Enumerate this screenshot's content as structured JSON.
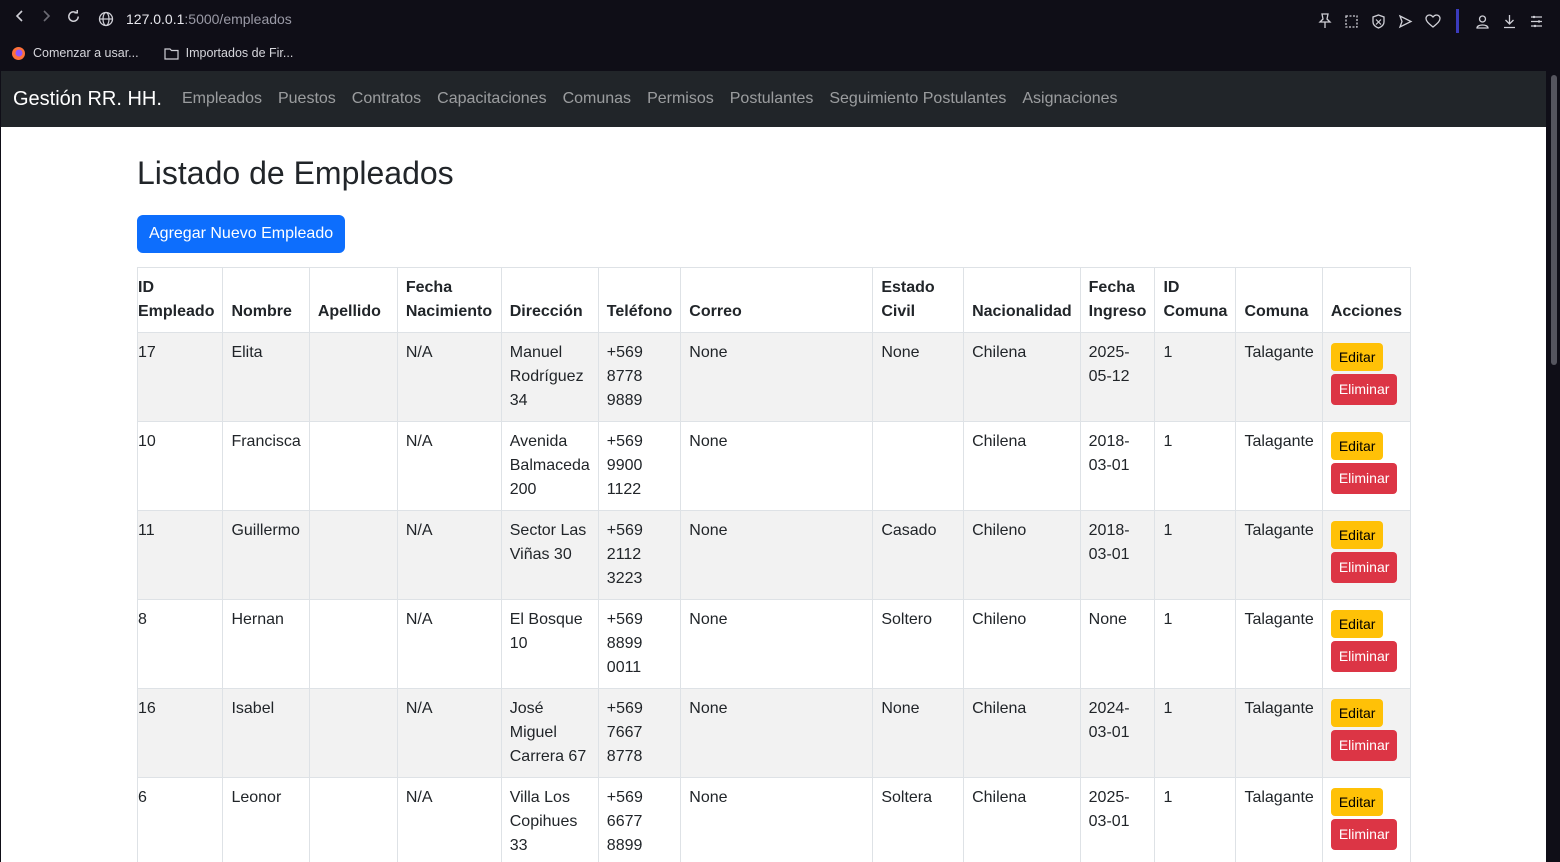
{
  "browser": {
    "url_host": "127.0.0.1",
    "url_path": ":5000/empleados",
    "bookmarks": [
      {
        "label": "Comenzar a usar...",
        "icon": "firefox-icon"
      },
      {
        "label": "Importados de Fir...",
        "icon": "folder-icon"
      }
    ],
    "accent_color": "#3b3bbd"
  },
  "navbar": {
    "brand": "Gestión RR. HH.",
    "links": [
      "Empleados",
      "Puestos",
      "Contratos",
      "Capacitaciones",
      "Comunas",
      "Permisos",
      "Postulantes",
      "Seguimiento Postulantes",
      "Asignaciones"
    ]
  },
  "page": {
    "title": "Listado de Empleados",
    "add_button": "Agregar Nuevo Empleado"
  },
  "table": {
    "headers": [
      "ID Empleado",
      "Nombre",
      "Apellido",
      "Fecha Nacimiento",
      "Dirección",
      "Teléfono",
      "Correo",
      "Estado Civil",
      "Nacionalidad",
      "Fecha Ingreso",
      "ID Comuna",
      "Comuna",
      "Acciones"
    ],
    "edit_label": "Editar",
    "delete_label": "Eliminar",
    "rows": [
      {
        "id": "17",
        "nombre": "Elita",
        "apellido": "",
        "fecha_nac": "N/A",
        "direccion": "Manuel Rodríguez 34",
        "telefono": "+569 8778 9889",
        "correo": "None",
        "estado_civil": "None",
        "nacionalidad": "Chilena",
        "fecha_ingreso": "2025-05-12",
        "id_comuna": "1",
        "comuna": "Talagante"
      },
      {
        "id": "10",
        "nombre": "Francisca",
        "apellido": "",
        "fecha_nac": "N/A",
        "direccion": "Avenida Balmaceda 200",
        "telefono": "+569 9900 1122",
        "correo": "None",
        "estado_civil": "",
        "nacionalidad": "Chilena",
        "fecha_ingreso": "2018-03-01",
        "id_comuna": "1",
        "comuna": "Talagante"
      },
      {
        "id": "11",
        "nombre": "Guillermo",
        "apellido": "",
        "fecha_nac": "N/A",
        "direccion": "Sector Las Viñas 30",
        "telefono": "+569 2112 3223",
        "correo": "None",
        "estado_civil": "Casado",
        "nacionalidad": "Chileno",
        "fecha_ingreso": "2018-03-01",
        "id_comuna": "1",
        "comuna": "Talagante"
      },
      {
        "id": "8",
        "nombre": "Hernan",
        "apellido": "",
        "fecha_nac": "N/A",
        "direccion": "El Bosque 10",
        "telefono": "+569 8899 0011",
        "correo": "None",
        "estado_civil": "Soltero",
        "nacionalidad": "Chileno",
        "fecha_ingreso": "None",
        "id_comuna": "1",
        "comuna": "Talagante"
      },
      {
        "id": "16",
        "nombre": "Isabel",
        "apellido": "",
        "fecha_nac": "N/A",
        "direccion": "José Miguel Carrera 67",
        "telefono": "+569 7667 8778",
        "correo": "None",
        "estado_civil": "None",
        "nacionalidad": "Chilena",
        "fecha_ingreso": "2024-03-01",
        "id_comuna": "1",
        "comuna": "Talagante"
      },
      {
        "id": "6",
        "nombre": "Leonor",
        "apellido": "",
        "fecha_nac": "N/A",
        "direccion": "Villa Los Copihues 33",
        "telefono": "+569 6677 8899",
        "correo": "None",
        "estado_civil": "Soltera",
        "nacionalidad": "Chilena",
        "fecha_ingreso": "2025-03-01",
        "id_comuna": "1",
        "comuna": "Talagante"
      }
    ]
  }
}
